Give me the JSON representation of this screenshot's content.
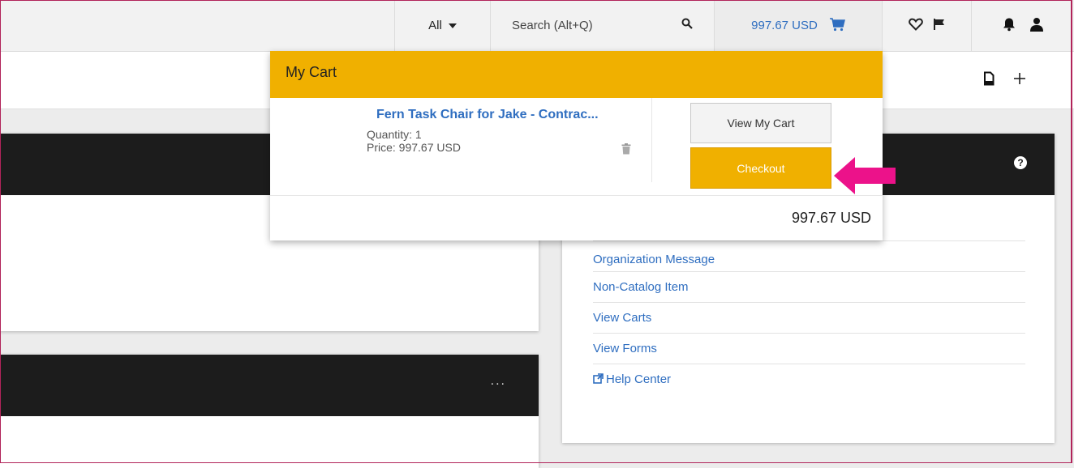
{
  "topbar": {
    "scope_label": "All",
    "search_placeholder": "Search (Alt+Q)",
    "cart_total": "997.67 USD"
  },
  "cart": {
    "title": "My Cart",
    "item": {
      "name": "Fern Task Chair for Jake - Contrac...",
      "quantity": "Quantity: 1",
      "price": "Price: 997.67 USD"
    },
    "view_cart_label": "View My Cart",
    "checkout_label": "Checkout",
    "total": "997.67 USD"
  },
  "right_panel": {
    "help_glyph": "?",
    "links": [
      {
        "label": "Organization Message"
      },
      {
        "label": "Non-Catalog Item"
      },
      {
        "label": "View Carts"
      },
      {
        "label": "View Forms"
      },
      {
        "label": "Help Center"
      }
    ]
  },
  "left_panel_2": {
    "menu_glyph": "..."
  },
  "colors": {
    "accent": "#f0b000",
    "link": "#2f6ec0",
    "dark_header": "#1c1c1c",
    "annotation_arrow": "#ec128a"
  },
  "icons": [
    "caret-down-icon",
    "search-icon",
    "cart-icon",
    "heart-icon",
    "flag-icon",
    "bell-icon",
    "user-icon",
    "document-icon",
    "plus-icon",
    "trash-icon",
    "help-icon",
    "external-link-icon",
    "ellipsis-icon",
    "pink-arrow"
  ]
}
